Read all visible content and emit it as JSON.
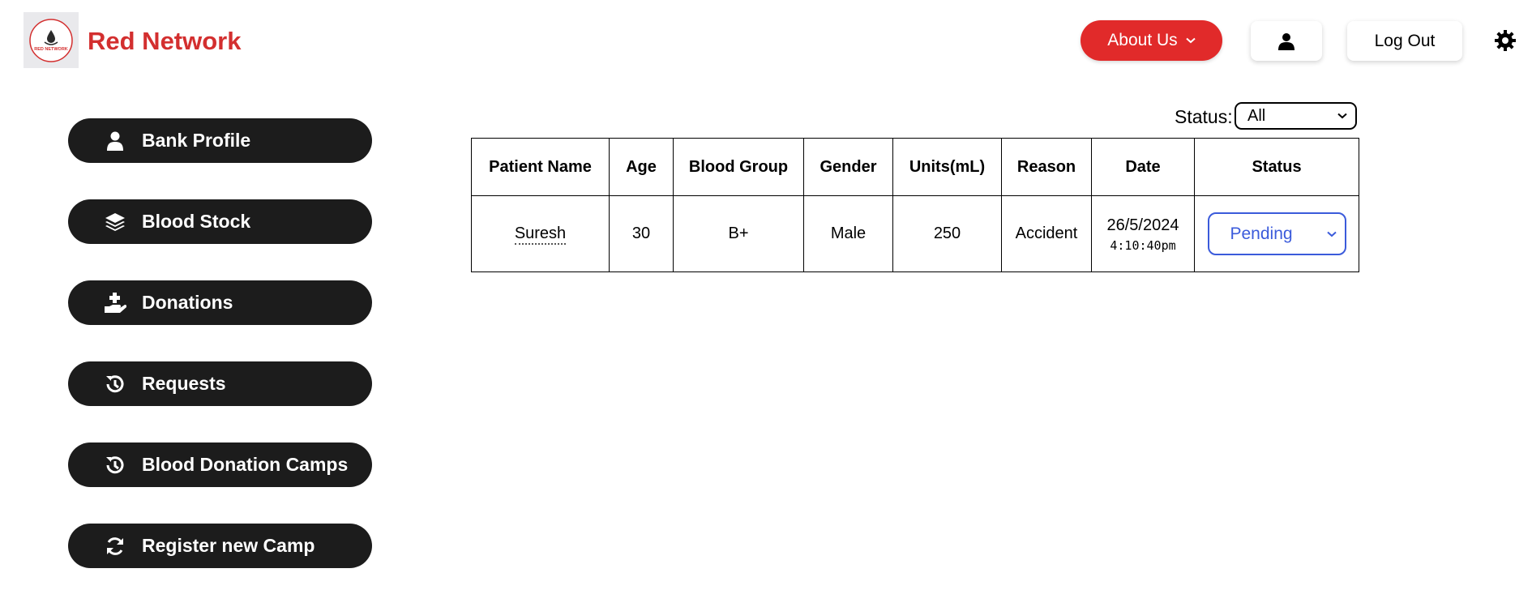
{
  "header": {
    "brand": "Red Network",
    "logo_text": "RED NETWORK",
    "about_label": "About Us",
    "logout_label": "Log Out",
    "accent_color": "#e12a2a"
  },
  "sidebar": {
    "items": [
      {
        "label": "Bank Profile",
        "icon": "user-icon"
      },
      {
        "label": "Blood Stock",
        "icon": "layers-icon"
      },
      {
        "label": "Donations",
        "icon": "hand-donate-icon"
      },
      {
        "label": "Requests",
        "icon": "history-icon"
      },
      {
        "label": "Blood Donation Camps",
        "icon": "history-icon"
      },
      {
        "label": "Register new Camp",
        "icon": "refresh-icon"
      }
    ]
  },
  "filter": {
    "label": "Status:",
    "selected": "All"
  },
  "table": {
    "headers": [
      "Patient Name",
      "Age",
      "Blood Group",
      "Gender",
      "Units(mL)",
      "Reason",
      "Date",
      "Status"
    ],
    "rows": [
      {
        "patient_name": "Suresh",
        "age": "30",
        "blood_group": "B+",
        "gender": "Male",
        "units": "250",
        "reason": "Accident",
        "date": "26/5/2024",
        "time": "4:10:40pm",
        "status": "Pending",
        "status_color": "#3b5bdb"
      }
    ]
  }
}
